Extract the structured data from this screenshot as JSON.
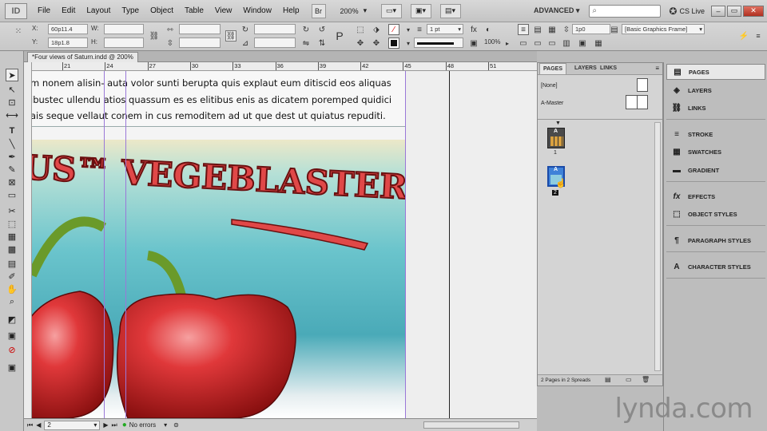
{
  "app": {
    "logo": "ID"
  },
  "menu": [
    "File",
    "Edit",
    "Layout",
    "Type",
    "Object",
    "Table",
    "View",
    "Window",
    "Help"
  ],
  "topbar": {
    "br_label": "Br",
    "zoom": "200%",
    "workspace": "ADVANCED",
    "cs_live": "CS Live",
    "search_placeholder": ""
  },
  "control": {
    "x_label": "X:",
    "x_value": "60p11.4",
    "y_label": "Y:",
    "y_value": "18p1.8",
    "w_label": "W:",
    "h_label": "H:",
    "stroke_weight": "1 pt",
    "opacity": "100%",
    "spacing_value": "1p0",
    "object_style": "[Basic Graphics Frame]"
  },
  "document": {
    "tab_title": "*Four views of Saturn.indd @ 200%",
    "ruler_ticks": [
      "21",
      "24",
      "27",
      "30",
      "33",
      "36",
      "39",
      "42",
      "45",
      "48",
      "51"
    ],
    "text_lines": [
      "m nonem alisin-      auta volor sunti berupta quis explaut eum ditiscid eos aliquas",
      "ibustec ullendu     atios quassum es es elitibus enis as dicatem poremped quidici",
      "ais seque vellaut      conem in cus remoditem ad ut que dest ut quiatus repuditi."
    ],
    "art_title": "US™ VEGEBLASTERS",
    "art_subtitle": "VEGEBLASTERS"
  },
  "status": {
    "page": "2",
    "preflight": "No errors"
  },
  "pages_panel": {
    "tabs": [
      "PAGES",
      "LAYERS",
      "LINKS"
    ],
    "none_label": "[None]",
    "master_label": "A-Master",
    "page1_label": "1",
    "page2_label": "2",
    "footer": "2 Pages in 2 Spreads",
    "page_master_letter": "A"
  },
  "dock": {
    "items": [
      {
        "label": "PAGES",
        "icon": "pages-icon"
      },
      {
        "label": "LAYERS",
        "icon": "layers-icon"
      },
      {
        "label": "LINKS",
        "icon": "links-icon"
      },
      {
        "label": "STROKE",
        "icon": "stroke-icon"
      },
      {
        "label": "SWATCHES",
        "icon": "swatches-icon"
      },
      {
        "label": "GRADIENT",
        "icon": "gradient-icon"
      },
      {
        "label": "EFFECTS",
        "icon": "effects-icon"
      },
      {
        "label": "OBJECT STYLES",
        "icon": "object-styles-icon"
      },
      {
        "label": "PARAGRAPH STYLES",
        "icon": "paragraph-styles-icon"
      },
      {
        "label": "CHARACTER STYLES",
        "icon": "character-styles-icon"
      }
    ]
  },
  "watermark": "lynda.com"
}
